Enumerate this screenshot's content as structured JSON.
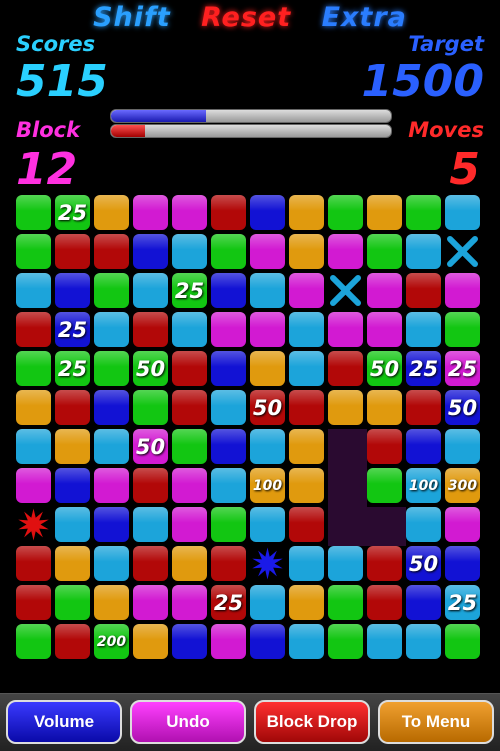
{
  "menu": {
    "shift": "Shift",
    "reset": "Reset",
    "extra": "Extra"
  },
  "stats": {
    "scores_label": "Scores",
    "scores_value": "515",
    "target_label": "Target",
    "target_value": "1500",
    "block_label": "Block",
    "block_value": "12",
    "moves_label": "Moves",
    "moves_value": "5",
    "progress_score": 0.34,
    "progress_moves": 0.12
  },
  "colors": {
    "G": "#12c612",
    "O": "#e09a0e",
    "M": "#d21ad2",
    "R": "#b20808",
    "B": "#1212d4",
    "C": "#1ca4da",
    "D": "#2a0a30",
    "accent_blue": "#2a60ff",
    "accent_red": "#ff2a2a"
  },
  "board": {
    "rows": [
      [
        "G",
        "G",
        "O",
        "M",
        "M",
        "R",
        "B",
        "O",
        "G",
        "O",
        "G",
        "C"
      ],
      [
        "G",
        "R",
        "R",
        "B",
        "C",
        "G",
        "M",
        "O",
        "M",
        "G",
        "C",
        "C"
      ],
      [
        "C",
        "B",
        "G",
        "C",
        "G",
        "B",
        "C",
        "M",
        "C",
        "M",
        "R",
        "M"
      ],
      [
        "R",
        "B",
        "C",
        "R",
        "C",
        "M",
        "M",
        "C",
        "M",
        "M",
        "C",
        "G"
      ],
      [
        "G",
        "G",
        "G",
        "G",
        "R",
        "B",
        "O",
        "C",
        "R",
        "G",
        "B",
        "M"
      ],
      [
        "O",
        "R",
        "B",
        "G",
        "R",
        "C",
        "R",
        "R",
        "O",
        "O",
        "R",
        "B"
      ],
      [
        "C",
        "O",
        "C",
        "M",
        "G",
        "B",
        "C",
        "O",
        "D",
        "R",
        "B",
        "C"
      ],
      [
        "M",
        "B",
        "M",
        "R",
        "M",
        "C",
        "O",
        "O",
        "D",
        "G",
        "C",
        "O"
      ],
      [
        "R",
        "C",
        "B",
        "C",
        "M",
        "G",
        "C",
        "R",
        "D",
        "D",
        "C",
        "M"
      ],
      [
        "R",
        "O",
        "C",
        "R",
        "O",
        "R",
        "B",
        "C",
        "C",
        "R",
        "B",
        "B"
      ],
      [
        "R",
        "G",
        "O",
        "M",
        "M",
        "R",
        "C",
        "O",
        "G",
        "R",
        "B",
        "C"
      ],
      [
        "G",
        "R",
        "G",
        "O",
        "B",
        "M",
        "B",
        "C",
        "G",
        "C",
        "C",
        "G"
      ]
    ],
    "labels": [
      {
        "r": 0,
        "c": 1,
        "text": "25"
      },
      {
        "r": 2,
        "c": 4,
        "text": "25"
      },
      {
        "r": 3,
        "c": 1,
        "text": "25"
      },
      {
        "r": 4,
        "c": 1,
        "text": "25"
      },
      {
        "r": 4,
        "c": 3,
        "text": "50"
      },
      {
        "r": 4,
        "c": 9,
        "text": "50"
      },
      {
        "r": 4,
        "c": 10,
        "text": "25"
      },
      {
        "r": 4,
        "c": 11,
        "text": "25"
      },
      {
        "r": 5,
        "c": 6,
        "text": "50"
      },
      {
        "r": 5,
        "c": 11,
        "text": "50"
      },
      {
        "r": 6,
        "c": 3,
        "text": "50"
      },
      {
        "r": 7,
        "c": 6,
        "text": "100"
      },
      {
        "r": 7,
        "c": 10,
        "text": "100"
      },
      {
        "r": 7,
        "c": 11,
        "text": "300"
      },
      {
        "r": 9,
        "c": 10,
        "text": "50"
      },
      {
        "r": 10,
        "c": 5,
        "text": "25"
      },
      {
        "r": 10,
        "c": 11,
        "text": "25"
      },
      {
        "r": 11,
        "c": 2,
        "text": "200"
      }
    ],
    "x_marks": [
      {
        "r": 1,
        "c": 11
      },
      {
        "r": 2,
        "c": 8
      }
    ],
    "bursts": [
      {
        "r": 8,
        "c": 0,
        "color": "#e01010"
      },
      {
        "r": 9,
        "c": 6,
        "color": "#1a1ae8"
      }
    ]
  },
  "buttons": {
    "volume": "Volume",
    "undo": "Undo",
    "block_drop": "Block Drop",
    "to_menu": "To Menu"
  }
}
